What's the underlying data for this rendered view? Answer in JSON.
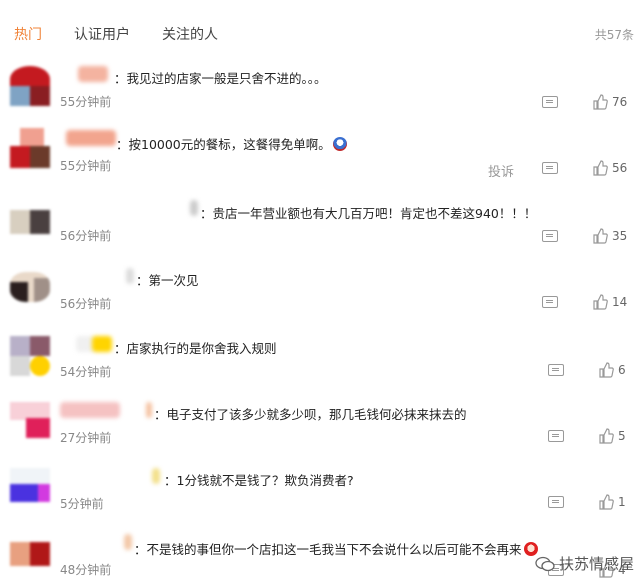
{
  "tabs": [
    {
      "label": "热门"
    },
    {
      "label": "认证用户"
    },
    {
      "label": "关注的人"
    }
  ],
  "total_label": "共57条",
  "report_label": "投诉",
  "watermark_text": "扶苏情感屋",
  "comments": [
    {
      "text": "：我见过的店家一般是只舍不进的。。。",
      "time": "55分钟前",
      "likes": "76"
    },
    {
      "text": "：按10000元的餐标，这餐得免单啊。",
      "time": "55分钟前",
      "likes": "56"
    },
    {
      "text": "：贵店一年营业额也有大几百万吧！肯定也不差这940！！！",
      "time": "56分钟前",
      "likes": "35"
    },
    {
      "text": "：第一次见",
      "time": "56分钟前",
      "likes": "14"
    },
    {
      "text": "：店家执行的是你舍我入规则",
      "time": "54分钟前",
      "likes": "6"
    },
    {
      "text": "：电子支付了该多少就多少呗，那几毛钱何必抹来抹去的",
      "time": "27分钟前",
      "likes": "5"
    },
    {
      "text": "：1分钱就不是钱了？欺负消费者?",
      "time": "5分钟前",
      "likes": "1"
    },
    {
      "text": "：不是钱的事但你一个店扣这一毛我当下不会说什么以后可能不会再来",
      "time": "48分钟前",
      "likes": "4"
    }
  ]
}
